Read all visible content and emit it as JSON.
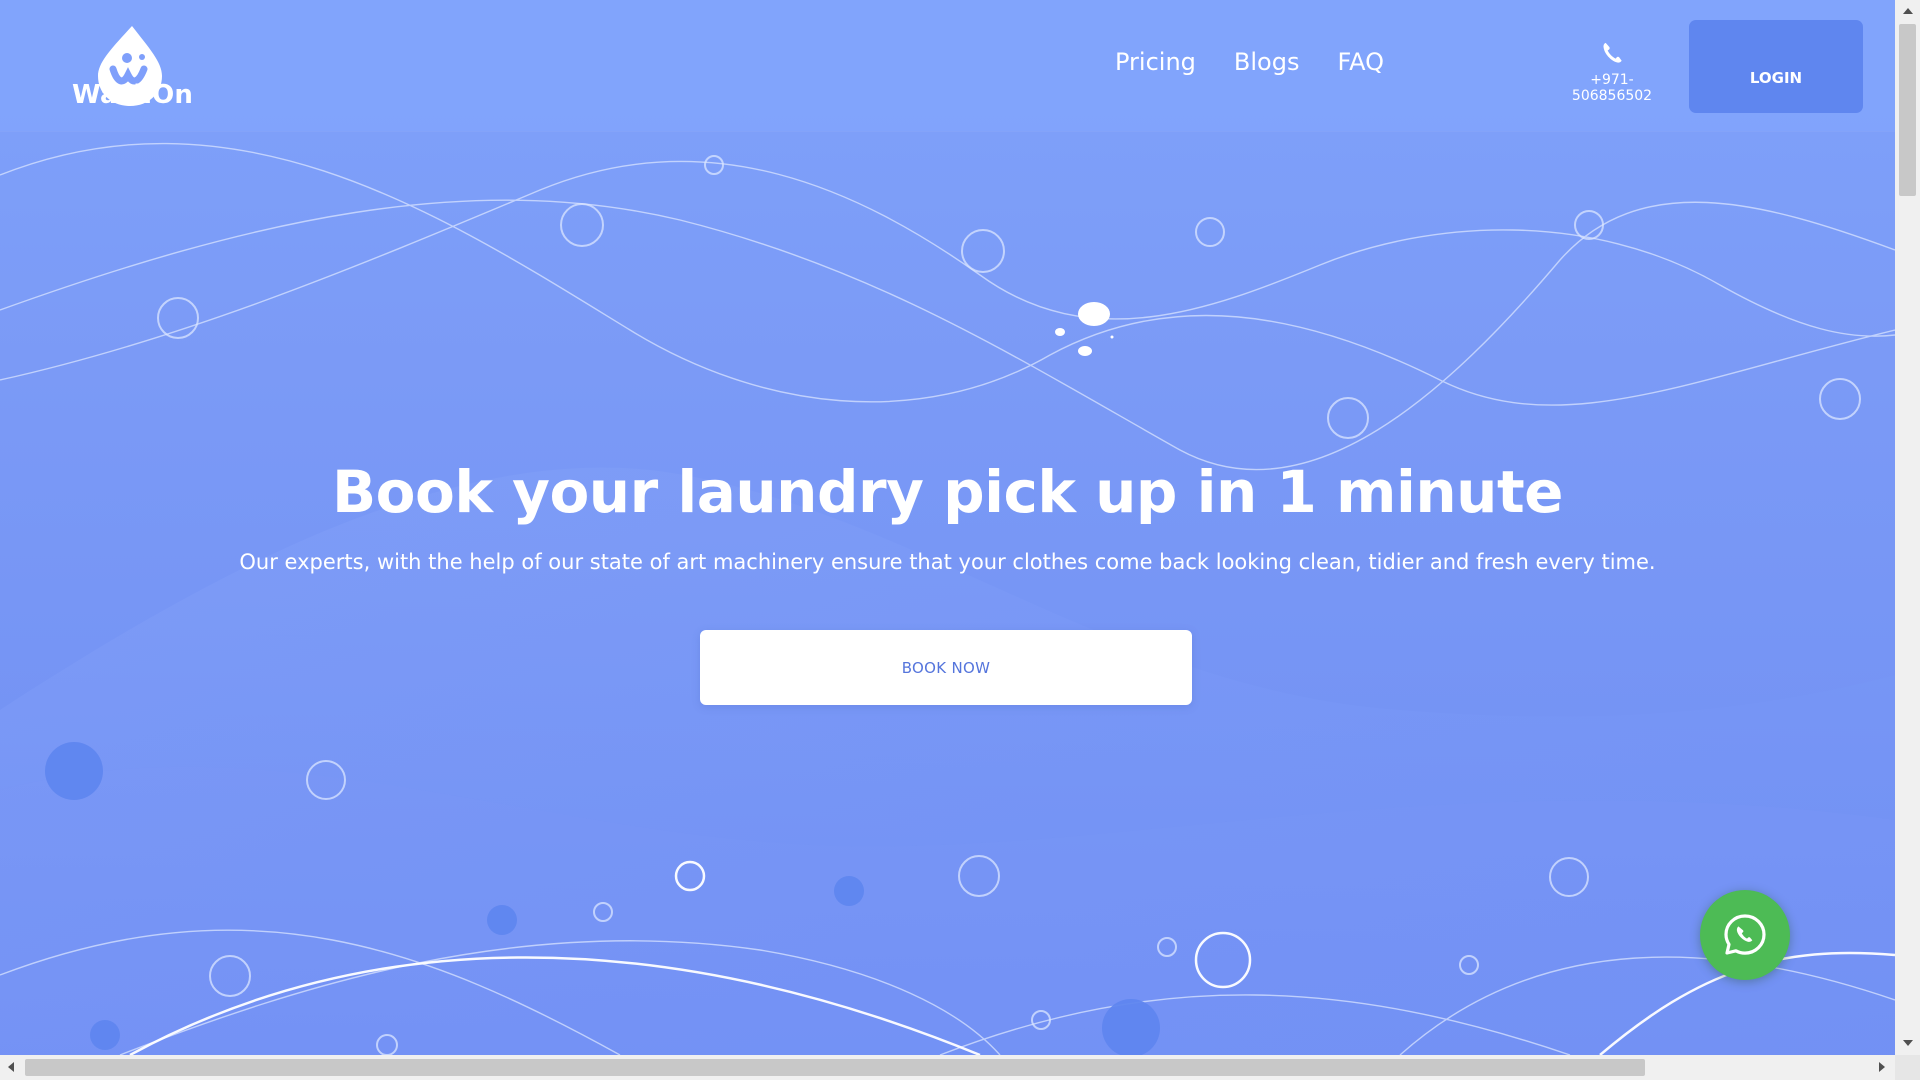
{
  "brand": {
    "name": "WashOn",
    "logo_icon": "washon-drop-logo"
  },
  "nav": {
    "items": [
      {
        "label": "Pricing"
      },
      {
        "label": "Blogs"
      },
      {
        "label": "FAQ"
      }
    ]
  },
  "contact": {
    "phone": "+971-506856502",
    "icon": "phone-icon"
  },
  "header": {
    "login_label": "LOGIN"
  },
  "hero": {
    "title": "Book your laundry pick up in 1 minute",
    "subtitle": "Our experts, with the help of our state of art machinery ensure that your clothes come back looking clean, tidier and fresh every time.",
    "book_button": "BOOK NOW"
  },
  "floating": {
    "whatsapp_icon": "whatsapp-icon"
  },
  "colors": {
    "background": "#7f9ffb",
    "login_button": "#5f86ef",
    "book_button_text": "#5575dc",
    "whatsapp": "#4dbb55"
  }
}
